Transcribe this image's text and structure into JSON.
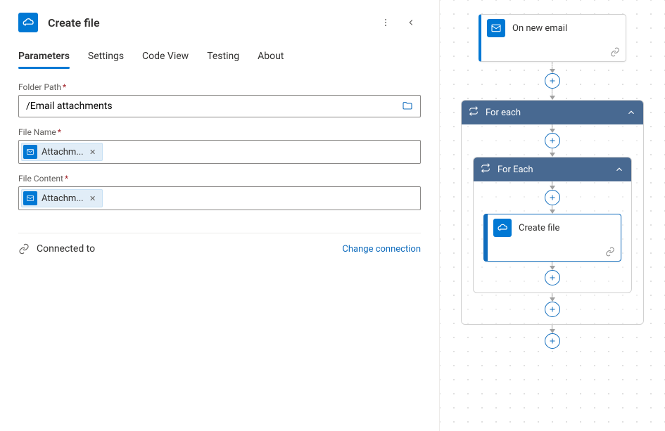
{
  "panel": {
    "title": "Create file",
    "tabs": {
      "parameters": "Parameters",
      "settings": "Settings",
      "codeView": "Code View",
      "testing": "Testing",
      "about": "About"
    },
    "fields": {
      "folderPath": {
        "label": "Folder Path",
        "value": "/Email attachments"
      },
      "fileName": {
        "label": "File Name",
        "token": "Attachm..."
      },
      "fileContent": {
        "label": "File Content",
        "token": "Attachm..."
      }
    },
    "connection": {
      "label": "Connected to",
      "changeLabel": "Change connection"
    }
  },
  "flow": {
    "trigger": "On new email",
    "forEachOuter": "For each",
    "forEachInner": "For Each",
    "action": "Create file"
  },
  "colors": {
    "brand": "#0078d4",
    "scopeHeader": "#486991",
    "link": "#0f6cbd"
  }
}
